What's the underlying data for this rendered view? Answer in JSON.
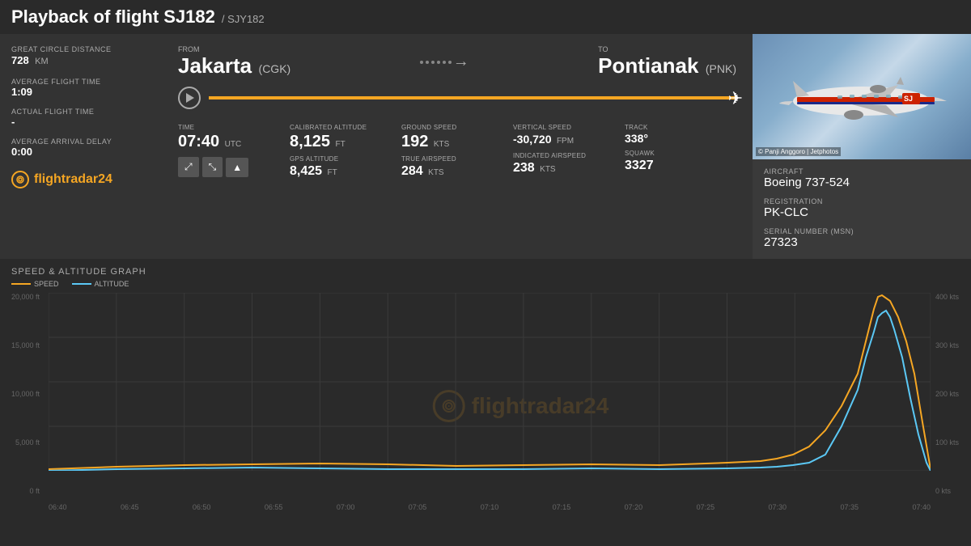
{
  "header": {
    "title": "Playback of flight SJ182",
    "iata": "/ SJY182"
  },
  "flight": {
    "from_label": "FROM",
    "from_city": "Jakarta",
    "from_code": "(CGK)",
    "to_label": "TO",
    "to_city": "Pontianak",
    "to_code": "(PNK)"
  },
  "left_stats": {
    "gcd_label": "GREAT CIRCLE DISTANCE",
    "gcd_value": "728",
    "gcd_unit": "KM",
    "avg_flight_label": "AVERAGE FLIGHT TIME",
    "avg_flight_value": "1:09",
    "actual_flight_label": "ACTUAL FLIGHT TIME",
    "actual_flight_value": "-",
    "avg_delay_label": "AVERAGE ARRIVAL DELAY",
    "avg_delay_value": "0:00"
  },
  "flight_data": {
    "time_label": "TIME",
    "time_value": "07:40",
    "time_unit": "UTC",
    "cal_alt_label": "CALIBRATED ALTITUDE",
    "cal_alt_value": "8,125",
    "cal_alt_unit": "FT",
    "gps_alt_label": "GPS ALTITUDE",
    "gps_alt_value": "8,425",
    "gps_alt_unit": "FT",
    "ground_speed_label": "GROUND SPEED",
    "ground_speed_value": "192",
    "ground_speed_unit": "KTS",
    "true_as_label": "TRUE AIRSPEED",
    "true_as_value": "284",
    "true_as_unit": "KTS",
    "vert_speed_label": "VERTICAL SPEED",
    "vert_speed_value": "-30,720",
    "vert_speed_unit": "FPM",
    "ind_as_label": "INDICATED AIRSPEED",
    "ind_as_value": "238",
    "ind_as_unit": "KTS",
    "track_label": "TRACK",
    "track_value": "338°",
    "squawk_label": "SQUAWK",
    "squawk_value": "3327"
  },
  "aircraft": {
    "type_label": "AIRCRAFT",
    "type_value": "Boeing 737-524",
    "reg_label": "REGISTRATION",
    "reg_value": "PK-CLC",
    "msn_label": "SERIAL NUMBER (MSN)",
    "msn_value": "27323",
    "photo_credit": "© Panji Anggoro | Jetphotos"
  },
  "logo": {
    "text": "flightradar24"
  },
  "graph": {
    "title": "SPEED & ALTITUDE GRAPH",
    "legend_speed": "SPEED",
    "legend_altitude": "ALTITUDE",
    "y_left_labels": [
      "20,000 ft",
      "15,000 ft",
      "10,000 ft",
      "5,000 ft",
      "0 ft"
    ],
    "y_right_labels": [
      "400 kts",
      "300 kts",
      "200 kts",
      "100 kts",
      "0 kts"
    ],
    "x_labels": [
      "06:40",
      "06:45",
      "06:50",
      "06:55",
      "07:00",
      "07:05",
      "07:10",
      "07:15",
      "07:20",
      "07:25",
      "07:30",
      "07:35",
      "07:40"
    ]
  },
  "controls": {
    "expand_label": "⤢",
    "path_label": "⤡",
    "chart_label": "▲"
  }
}
